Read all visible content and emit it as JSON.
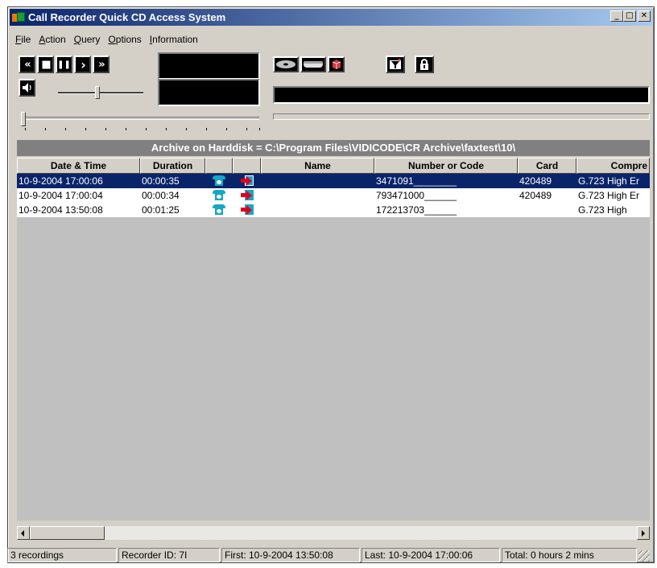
{
  "window": {
    "title": "Call Recorder Quick CD Access System",
    "min_glyph": "_",
    "max_glyph": "□",
    "close_glyph": "✕"
  },
  "menu": [
    "File",
    "Action",
    "Query",
    "Options",
    "Information"
  ],
  "transport": {
    "rewind": "«",
    "stop": "■",
    "pause": "❚❚",
    "play": "›",
    "forward": "»"
  },
  "archive_header": "Archive on Harddisk = C:\\Program Files\\VIDICODE\\CR Archive\\faxtest\\10\\",
  "table": {
    "columns": [
      "Date & Time",
      "Duration",
      "",
      "",
      "Name",
      "Number or Code",
      "Card",
      "Compre"
    ],
    "rows": [
      {
        "date": "10-9-2004 17:00:06",
        "duration": "00:00:35",
        "name": "",
        "number": "3471091________",
        "card": "420489",
        "compression": "G.723 High Er",
        "selected": true
      },
      {
        "date": "10-9-2004 17:00:04",
        "duration": "00:00:34",
        "name": "",
        "number": "793471000______",
        "card": "420489",
        "compression": "G.723 High Er",
        "selected": false
      },
      {
        "date": "10-9-2004 13:50:08",
        "duration": "00:01:25",
        "name": "",
        "number": "172213703______",
        "card": "",
        "compression": "G.723 High",
        "selected": false
      }
    ]
  },
  "status": {
    "count": "3 recordings",
    "recorder_id": "Recorder ID: 7I",
    "first": "First:  10-9-2004 13:50:08",
    "last": "Last:  10-9-2004 17:00:06",
    "total": "Total: 0 hours 2 mins"
  },
  "colors": {
    "title_gradient_start": "#0a246a",
    "title_gradient_end": "#a6caf0",
    "selection": "#0a246a",
    "archive_header_bg": "#808080",
    "icon_cyan": "#15a6c8",
    "arrow_red": "#e0001a"
  }
}
